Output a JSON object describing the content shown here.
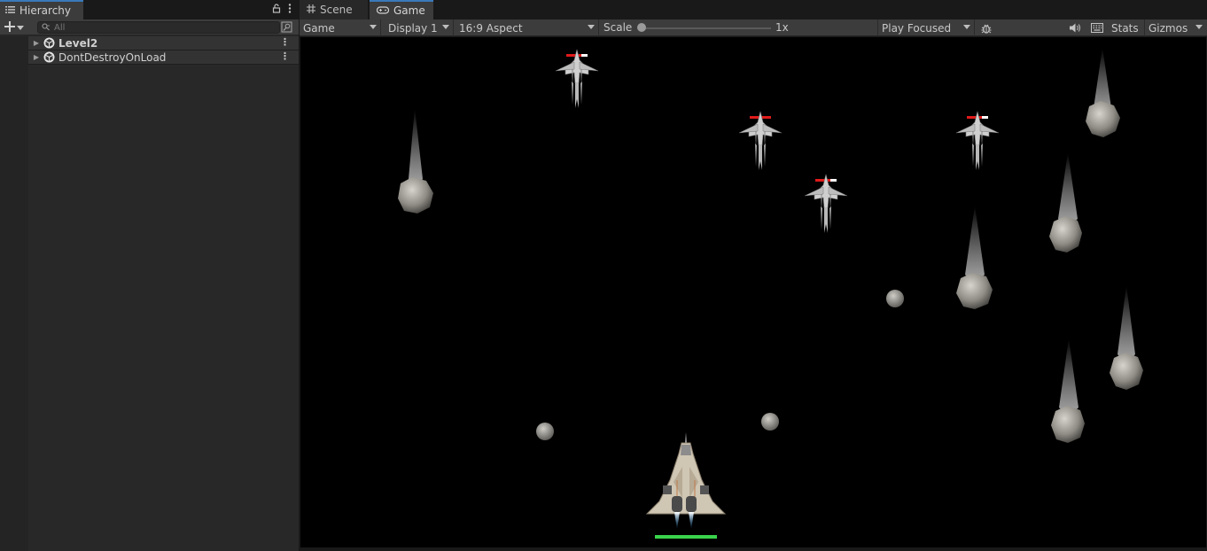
{
  "hierarchy": {
    "tab_label": "Hierarchy",
    "search_placeholder": "All",
    "items": [
      {
        "label": "Level2"
      },
      {
        "label": "DontDestroyOnLoad"
      }
    ]
  },
  "game_view": {
    "tabs": [
      {
        "label": "Scene"
      },
      {
        "label": "Game"
      }
    ],
    "toolbar": {
      "mode": "Game",
      "display": "Display 1",
      "aspect": "16:9 Aspect",
      "scale_label": "Scale",
      "scale_value": "1x",
      "play_mode": "Play Focused",
      "stats_label": "Stats",
      "gizmos_label": "Gizmos"
    }
  },
  "colors": {
    "accent": "#3a79bb",
    "player_health": "#39d34b",
    "enemy_health": "#e01a1a",
    "background": "#000000"
  }
}
